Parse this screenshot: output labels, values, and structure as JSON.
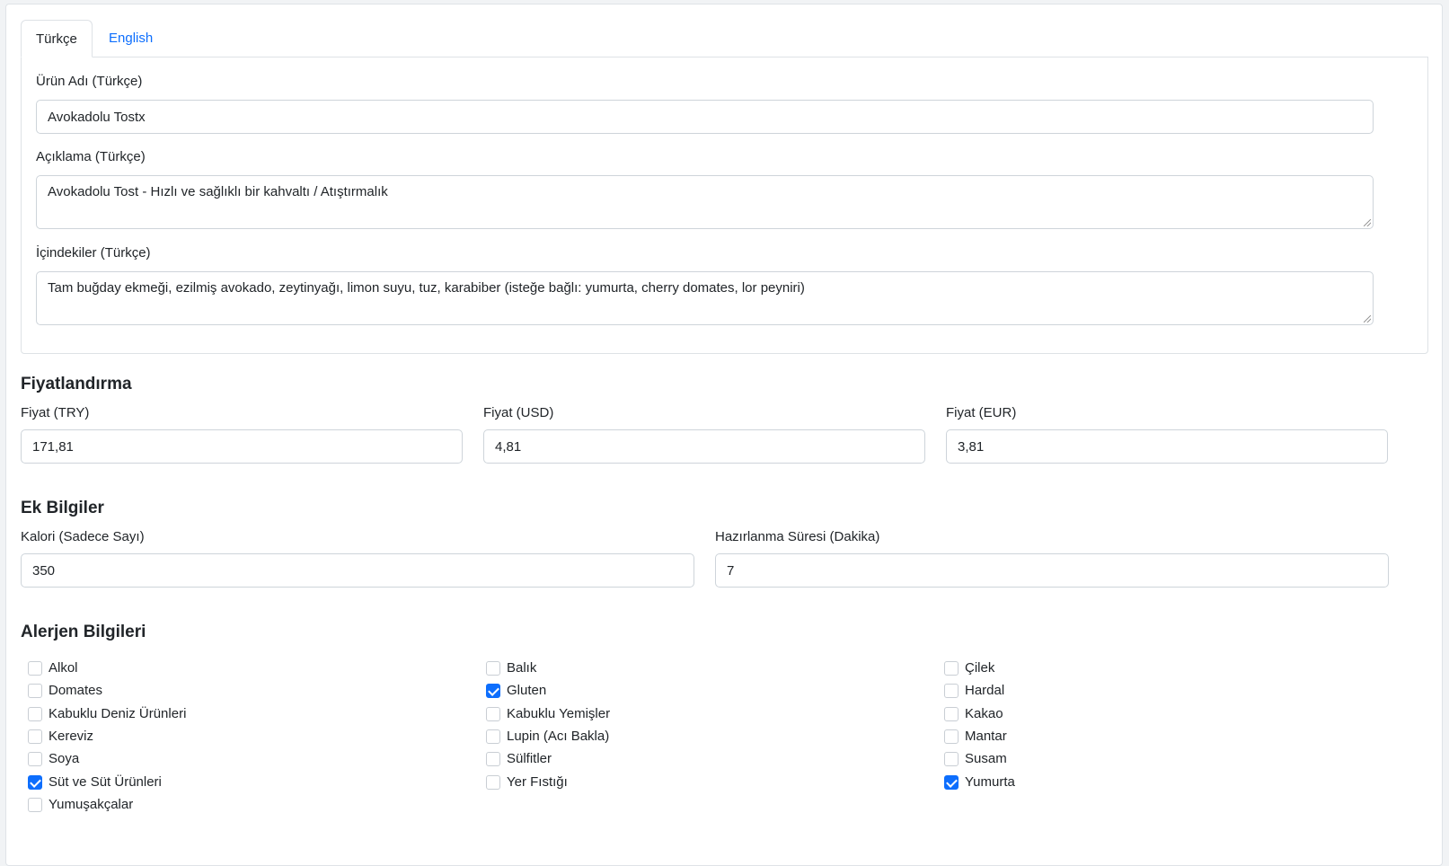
{
  "tabs": [
    {
      "label": "Türkçe",
      "active": true
    },
    {
      "label": "English",
      "active": false
    }
  ],
  "turkish": {
    "name_label": "Ürün Adı (Türkçe)",
    "name_value": "Avokadolu Tostx",
    "desc_label": "Açıklama (Türkçe)",
    "desc_value": "Avokadolu Tost - Hızlı ve sağlıklı bir kahvaltı / Atıştırmalık",
    "ingredients_label": "İçindekiler (Türkçe)",
    "ingredients_value": "Tam buğday ekmeği, ezilmiş avokado, zeytinyağı, limon suyu, tuz, karabiber (isteğe bağlı: yumurta, cherry domates, lor peyniri)"
  },
  "pricing": {
    "title": "Fiyatlandırma",
    "try_label": "Fiyat (TRY)",
    "try_value": "171,81",
    "usd_label": "Fiyat (USD)",
    "usd_value": "4,81",
    "eur_label": "Fiyat (EUR)",
    "eur_value": "3,81"
  },
  "extra": {
    "title": "Ek Bilgiler",
    "calorie_label": "Kalori (Sadece Sayı)",
    "calorie_value": "350",
    "prep_label": "Hazırlanma Süresi (Dakika)",
    "prep_value": "7"
  },
  "allergens": {
    "title": "Alerjen Bilgileri",
    "items": [
      {
        "label": "Alkol",
        "checked": false
      },
      {
        "label": "Domates",
        "checked": false
      },
      {
        "label": "Kabuklu Deniz Ürünleri",
        "checked": false
      },
      {
        "label": "Kereviz",
        "checked": false
      },
      {
        "label": "Soya",
        "checked": false
      },
      {
        "label": "Süt ve Süt Ürünleri",
        "checked": true
      },
      {
        "label": "Yumuşakçalar",
        "checked": false
      },
      {
        "label": "Balık",
        "checked": false
      },
      {
        "label": "Gluten",
        "checked": true
      },
      {
        "label": "Kabuklu Yemişler",
        "checked": false
      },
      {
        "label": "Lupin (Acı Bakla)",
        "checked": false
      },
      {
        "label": "Sülfitler",
        "checked": false
      },
      {
        "label": "Yer Fıstığı",
        "checked": false
      },
      {
        "label": "Çilek",
        "checked": false
      },
      {
        "label": "Hardal",
        "checked": false
      },
      {
        "label": "Kakao",
        "checked": false
      },
      {
        "label": "Mantar",
        "checked": false
      },
      {
        "label": "Susam",
        "checked": false
      },
      {
        "label": "Yumurta",
        "checked": true
      }
    ]
  }
}
